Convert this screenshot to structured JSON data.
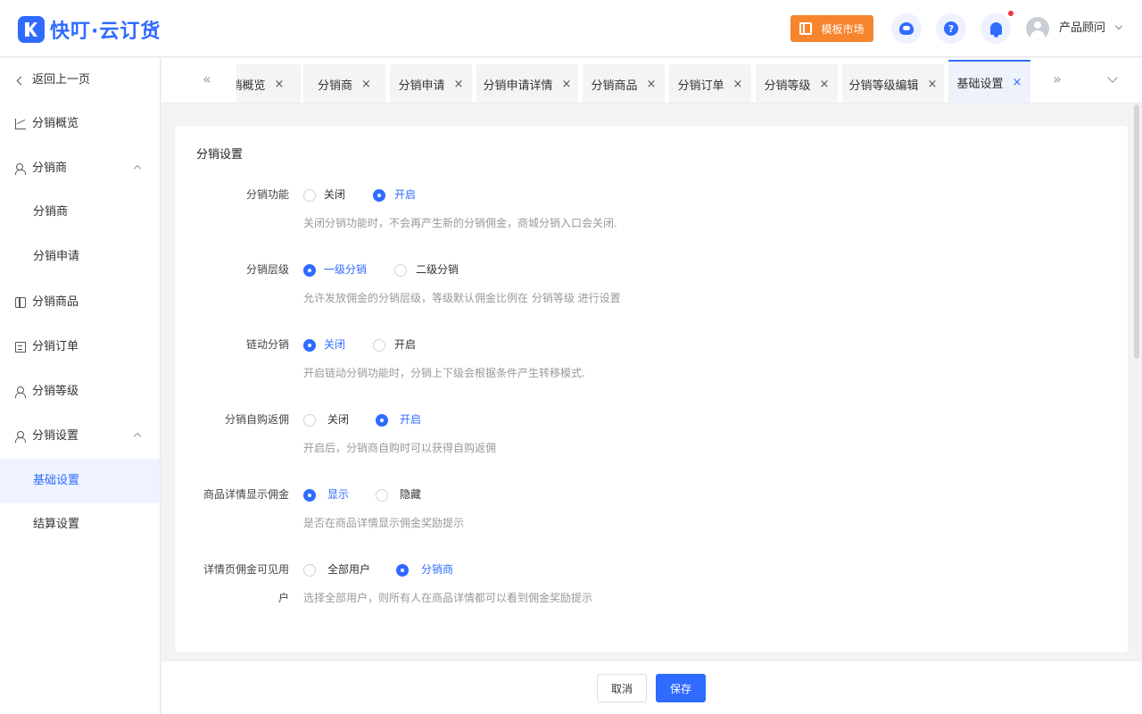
{
  "header": {
    "logo_text": "快叮·云订货",
    "template_market": "模板市场",
    "user_name": "产品顾问",
    "accent_color": "#2f6bff",
    "template_btn_color": "#f7852e"
  },
  "sidebar": {
    "back": "返回上一页",
    "items": [
      {
        "label": "分销概览",
        "icon": "chart-icon"
      },
      {
        "label": "分销商",
        "icon": "users-icon",
        "expanded": true
      },
      {
        "label": "分销商"
      },
      {
        "label": "分销申请"
      },
      {
        "label": "分销商品",
        "icon": "box-icon"
      },
      {
        "label": "分销订单",
        "icon": "order-icon"
      },
      {
        "label": "分销等级",
        "icon": "person-icon"
      },
      {
        "label": "分销设置",
        "icon": "person-icon",
        "expanded": true
      },
      {
        "label": "基础设置",
        "active": true
      },
      {
        "label": "结算设置"
      }
    ]
  },
  "tabs": {
    "scroll_left": "«",
    "scroll_right": "»",
    "items": [
      {
        "label": "分销概览"
      },
      {
        "label": "分销商"
      },
      {
        "label": "分销申请"
      },
      {
        "label": "分销申请详情"
      },
      {
        "label": "分销商品"
      },
      {
        "label": "分销订单"
      },
      {
        "label": "分销等级"
      },
      {
        "label": "分销等级编辑"
      },
      {
        "label": "基础设置",
        "active": true
      }
    ],
    "close_glyph": "×"
  },
  "main": {
    "section_title": "分销设置",
    "settings": [
      {
        "label": "分销功能",
        "options": [
          "关闭",
          "开启"
        ],
        "selected": 1,
        "help": "关闭分销功能时，不会再产生新的分销佣金，商城分销入口会关闭."
      },
      {
        "label": "分销层级",
        "options": [
          "一级分销",
          "二级分销"
        ],
        "selected": 0,
        "help": "允许发放佣金的分销层级，等级默认佣金比例在 分销等级 进行设置"
      },
      {
        "label": "链动分销",
        "options": [
          "关闭",
          "开启"
        ],
        "selected": 0,
        "help": "开启链动分销功能时，分销上下级会根据条件产生转移模式."
      },
      {
        "label": "分销自购返佣",
        "options": [
          "关闭",
          "开启"
        ],
        "selected": 1,
        "help": "开启后，分销商自购时可以获得自购返佣"
      },
      {
        "label": "商品详情显示佣金",
        "options": [
          "显示",
          "隐藏"
        ],
        "selected": 0,
        "help": "是否在商品详情显示佣金奖励提示"
      },
      {
        "label_line1": "详情页佣金可见用",
        "label_line2": "户",
        "options": [
          "全部用户",
          "分销商"
        ],
        "selected": 1,
        "help": "选择全部用户，则所有人在商品详情都可以看到佣金奖励提示"
      }
    ]
  },
  "footer": {
    "cancel": "取消",
    "save": "保存"
  }
}
